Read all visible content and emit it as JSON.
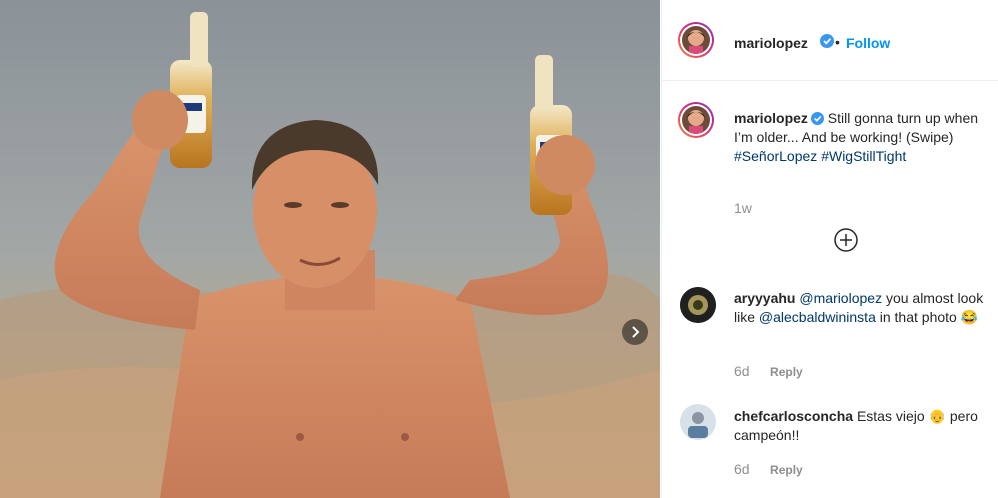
{
  "post": {
    "author": "mariolopez",
    "separator": "•",
    "follow_label": "Follow",
    "more_icon": "more-horizontal-icon",
    "caption_parts": {
      "text1": "Still gonna turn up when I’m older... And be working! (Swipe)",
      "hashtag1": "#SeñorLopez",
      "hashtag2": "#WigStillTight"
    },
    "caption_time": "1w",
    "load_more_icon": "plus-circle-icon",
    "carousel_next_icon": "chevron-right-icon"
  },
  "comments": [
    {
      "user": "aryyyahu",
      "mention": "@mariolopez",
      "text_a": " you almost look like ",
      "mention2": "@alecbaldwininsta",
      "text_b": " in that photo ",
      "emoji": "😂",
      "time": "6d",
      "reply": "Reply"
    },
    {
      "user": "chefcarlosconcha",
      "text_a": " Estas viejo ",
      "emoji": "👴",
      "text_b": " pero campeón!!",
      "time": "6d",
      "reply": "Reply"
    }
  ],
  "colors": {
    "follow": "#0095f6",
    "verified": "#3897f0",
    "link": "#00376b",
    "muted": "#8e8e8e"
  }
}
